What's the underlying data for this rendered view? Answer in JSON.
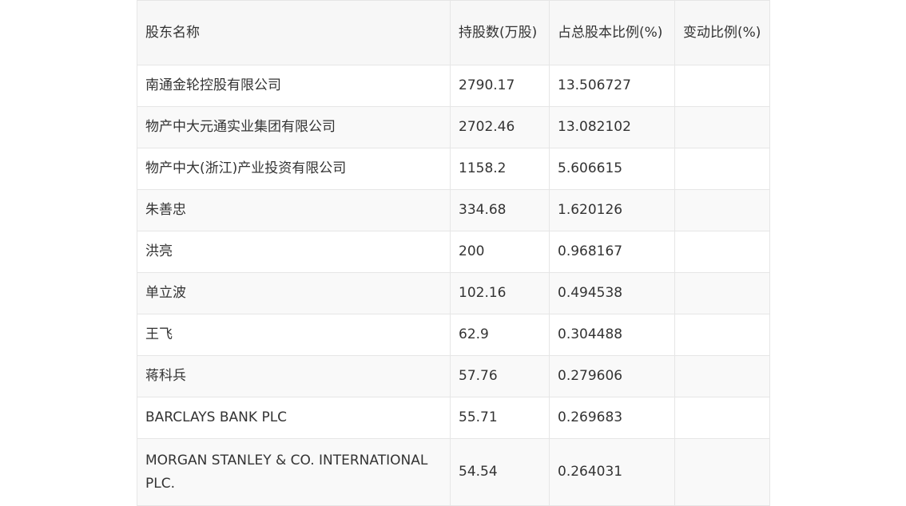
{
  "table": {
    "headers": [
      "股东名称",
      "持股数(万股)",
      "占总股本比例(%)",
      "变动比例(%)"
    ],
    "rows": [
      {
        "name": "南通金轮控股有限公司",
        "shares": "2790.17",
        "ratio": "13.506727",
        "change": ""
      },
      {
        "name": "物产中大元通实业集团有限公司",
        "shares": "2702.46",
        "ratio": "13.082102",
        "change": ""
      },
      {
        "name": "物产中大(浙江)产业投资有限公司",
        "shares": "1158.2",
        "ratio": "5.606615",
        "change": ""
      },
      {
        "name": "朱善忠",
        "shares": "334.68",
        "ratio": "1.620126",
        "change": ""
      },
      {
        "name": "洪亮",
        "shares": "200",
        "ratio": "0.968167",
        "change": ""
      },
      {
        "name": "单立波",
        "shares": "102.16",
        "ratio": "0.494538",
        "change": ""
      },
      {
        "name": "王飞",
        "shares": "62.9",
        "ratio": "0.304488",
        "change": ""
      },
      {
        "name": "蒋科兵",
        "shares": "57.76",
        "ratio": "0.279606",
        "change": ""
      },
      {
        "name": "BARCLAYS BANK PLC",
        "shares": "55.71",
        "ratio": "0.269683",
        "change": ""
      },
      {
        "name": "MORGAN STANLEY & CO. INTERNATIONAL PLC.",
        "shares": "54.54",
        "ratio": "0.264031",
        "change": ""
      }
    ]
  }
}
